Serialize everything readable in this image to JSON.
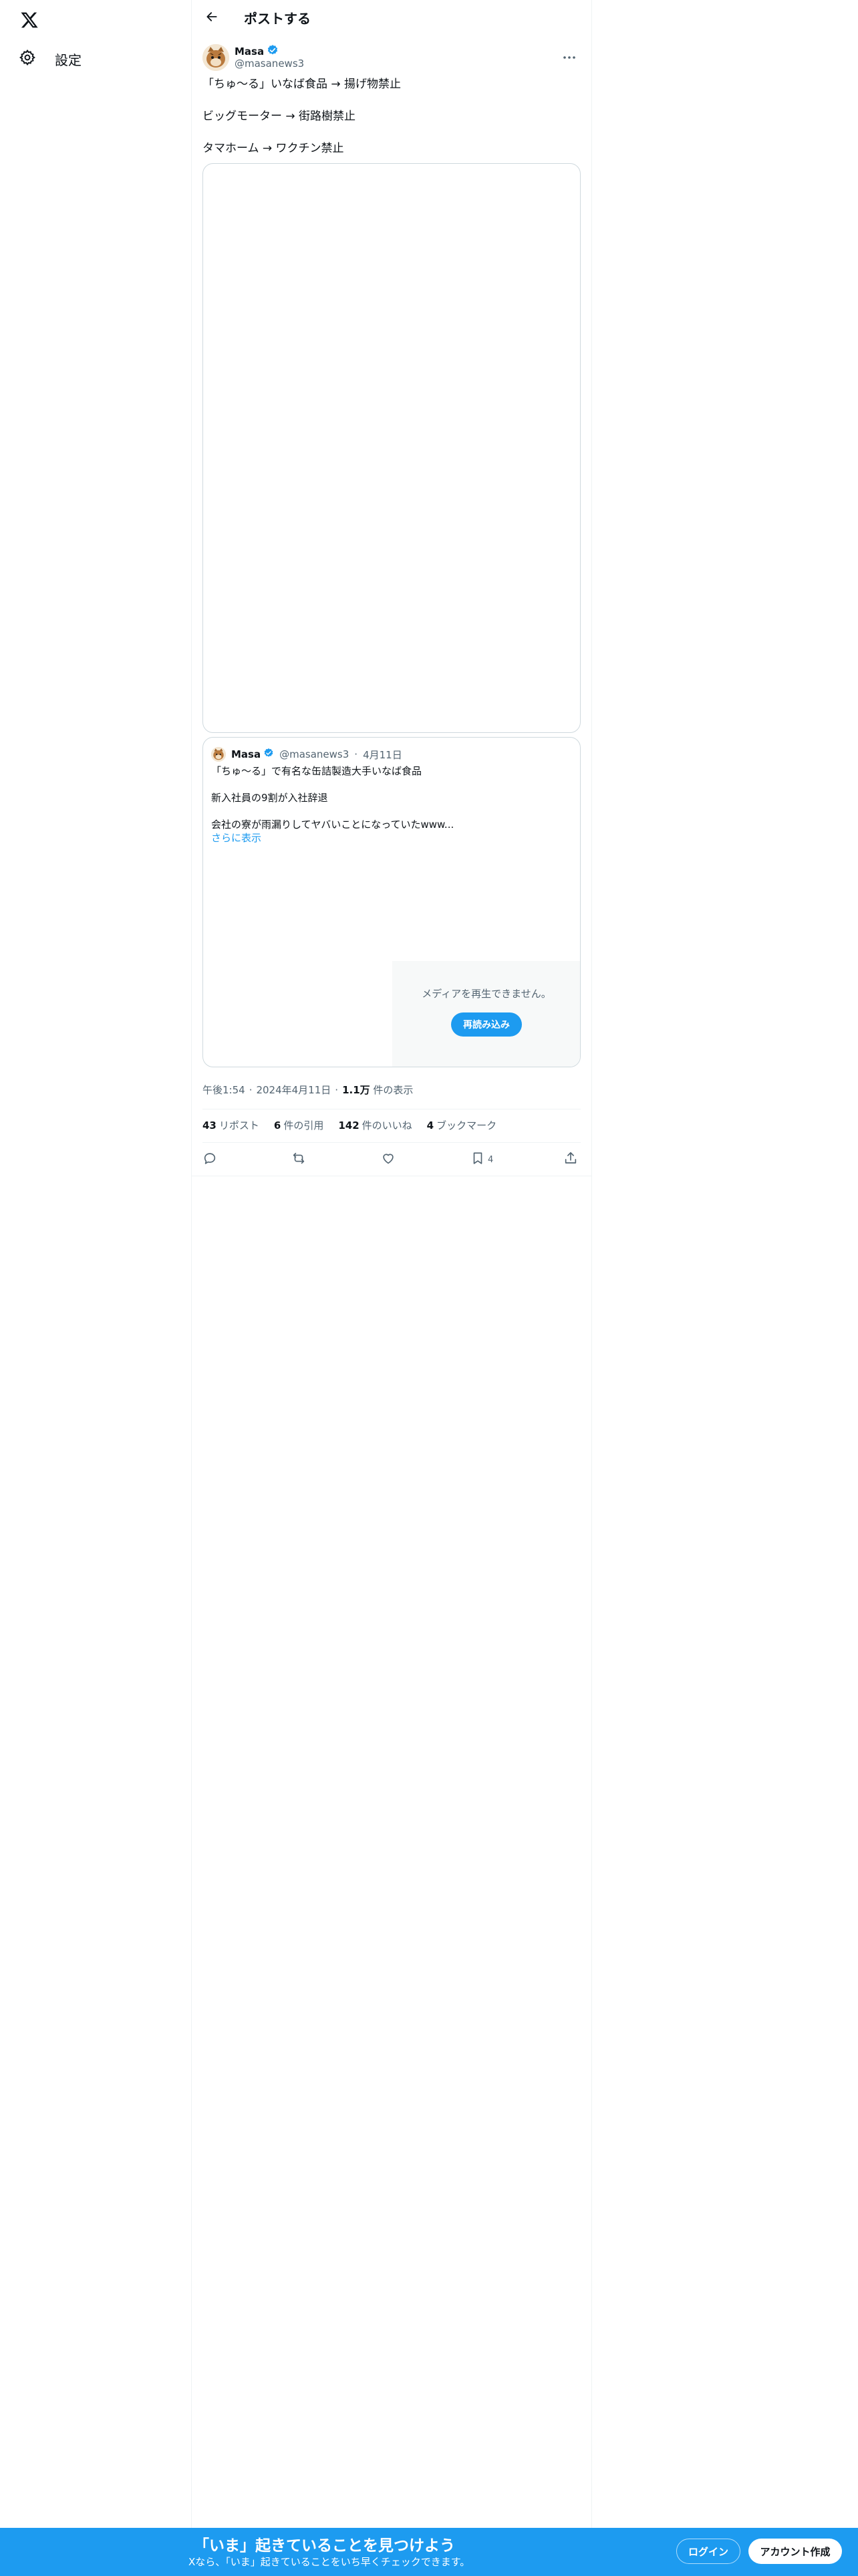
{
  "nav": {
    "logo_icon": "x-logo-icon",
    "settings_label": "設定"
  },
  "header": {
    "title": "ポストする"
  },
  "post": {
    "author_name": "Masa",
    "author_handle": "@masanews3",
    "lines": [
      "「ちゅ〜る」いなば食品 → 揚げ物禁止",
      "ビッグモーター → 街路樹禁止",
      "タマホーム → ワクチン禁止"
    ]
  },
  "quote": {
    "author_name": "Masa",
    "author_handle": "@masanews3",
    "separator": "·",
    "date": "4月11日",
    "lines": [
      "「ちゅ〜る」で有名な缶詰製造大手いなば食品",
      "新入社員の9割が入社辞退",
      "会社の寮が雨漏りしてヤバいことになっていたwww..."
    ],
    "show_more": "さらに表示",
    "media_error": "メディアを再生できません。",
    "reload_label": "再読み込み"
  },
  "meta": {
    "time": "午後1:54",
    "sep": "·",
    "date": "2024年4月11日",
    "views_count": "1.1万",
    "views_label": "件の表示"
  },
  "stats": {
    "reposts_count": "43",
    "reposts_label": "リポスト",
    "quotes_count": "6",
    "quotes_label": "件の引用",
    "likes_count": "142",
    "likes_label": "件のいいね",
    "bookmarks_count": "4",
    "bookmarks_label": "ブックマーク"
  },
  "actions": {
    "bookmark_count": "4"
  },
  "bottom_bar": {
    "title": "「いま」起きていることを見つけよう",
    "subtitle": "Xなら、「いま」起きていることをいち早くチェックできます。",
    "login_label": "ログイン",
    "signup_label": "アカウント作成"
  },
  "colors": {
    "accent": "#1d9bf0",
    "text": "#0f1419",
    "secondary": "#536471",
    "border": "#cfd9de"
  }
}
